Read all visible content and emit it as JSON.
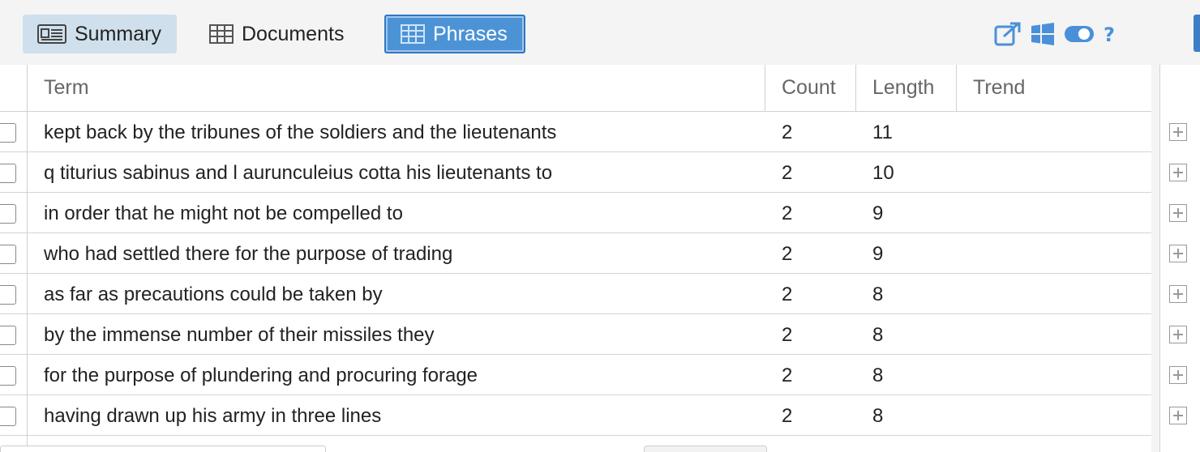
{
  "tabs": {
    "summary": "Summary",
    "documents": "Documents",
    "phrases": "Phrases"
  },
  "toolbar_icons": [
    "export-icon",
    "windows-icon",
    "toggle-icon",
    "help-icon"
  ],
  "colors": {
    "accent": "#4c93d6",
    "summary_tab_bg": "#cfe0ec",
    "icon_blue": "#4a90d9"
  },
  "table": {
    "columns": {
      "term": "Term",
      "count": "Count",
      "length": "Length",
      "trend": "Trend"
    },
    "rows": [
      {
        "term": "kept back by the tribunes of the soldiers and the lieutenants",
        "count": "2",
        "length": "11",
        "trend": ""
      },
      {
        "term": "q titurius sabinus and l aurunculeius cotta his lieutenants to",
        "count": "2",
        "length": "10",
        "trend": ""
      },
      {
        "term": "in order that he might not be compelled to",
        "count": "2",
        "length": "9",
        "trend": ""
      },
      {
        "term": "who had settled there for the purpose of trading",
        "count": "2",
        "length": "9",
        "trend": ""
      },
      {
        "term": "as far as precautions could be taken by",
        "count": "2",
        "length": "8",
        "trend": ""
      },
      {
        "term": "by the immense number of their missiles they",
        "count": "2",
        "length": "8",
        "trend": ""
      },
      {
        "term": "for the purpose of plundering and procuring forage",
        "count": "2",
        "length": "8",
        "trend": ""
      },
      {
        "term": "having drawn up his army in three lines",
        "count": "2",
        "length": "8",
        "trend": ""
      }
    ]
  }
}
